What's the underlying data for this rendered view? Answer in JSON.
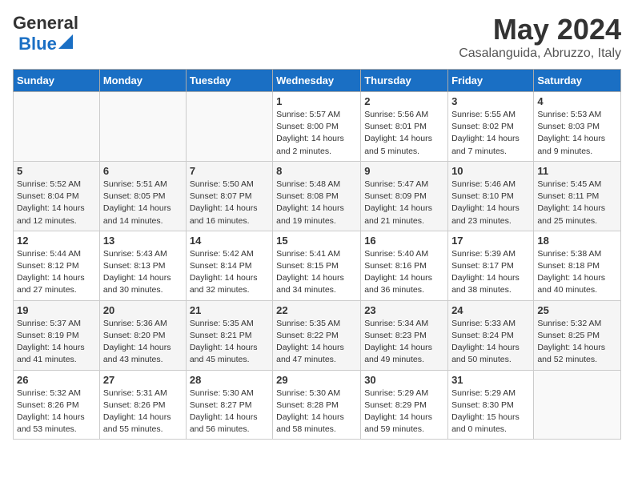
{
  "header": {
    "logo_top": "General",
    "logo_bottom": "Blue",
    "month": "May 2024",
    "location": "Casalanguida, Abruzzo, Italy"
  },
  "weekdays": [
    "Sunday",
    "Monday",
    "Tuesday",
    "Wednesday",
    "Thursday",
    "Friday",
    "Saturday"
  ],
  "weeks": [
    [
      {
        "day": "",
        "info": ""
      },
      {
        "day": "",
        "info": ""
      },
      {
        "day": "",
        "info": ""
      },
      {
        "day": "1",
        "info": "Sunrise: 5:57 AM\nSunset: 8:00 PM\nDaylight: 14 hours\nand 2 minutes."
      },
      {
        "day": "2",
        "info": "Sunrise: 5:56 AM\nSunset: 8:01 PM\nDaylight: 14 hours\nand 5 minutes."
      },
      {
        "day": "3",
        "info": "Sunrise: 5:55 AM\nSunset: 8:02 PM\nDaylight: 14 hours\nand 7 minutes."
      },
      {
        "day": "4",
        "info": "Sunrise: 5:53 AM\nSunset: 8:03 PM\nDaylight: 14 hours\nand 9 minutes."
      }
    ],
    [
      {
        "day": "5",
        "info": "Sunrise: 5:52 AM\nSunset: 8:04 PM\nDaylight: 14 hours\nand 12 minutes."
      },
      {
        "day": "6",
        "info": "Sunrise: 5:51 AM\nSunset: 8:05 PM\nDaylight: 14 hours\nand 14 minutes."
      },
      {
        "day": "7",
        "info": "Sunrise: 5:50 AM\nSunset: 8:07 PM\nDaylight: 14 hours\nand 16 minutes."
      },
      {
        "day": "8",
        "info": "Sunrise: 5:48 AM\nSunset: 8:08 PM\nDaylight: 14 hours\nand 19 minutes."
      },
      {
        "day": "9",
        "info": "Sunrise: 5:47 AM\nSunset: 8:09 PM\nDaylight: 14 hours\nand 21 minutes."
      },
      {
        "day": "10",
        "info": "Sunrise: 5:46 AM\nSunset: 8:10 PM\nDaylight: 14 hours\nand 23 minutes."
      },
      {
        "day": "11",
        "info": "Sunrise: 5:45 AM\nSunset: 8:11 PM\nDaylight: 14 hours\nand 25 minutes."
      }
    ],
    [
      {
        "day": "12",
        "info": "Sunrise: 5:44 AM\nSunset: 8:12 PM\nDaylight: 14 hours\nand 27 minutes."
      },
      {
        "day": "13",
        "info": "Sunrise: 5:43 AM\nSunset: 8:13 PM\nDaylight: 14 hours\nand 30 minutes."
      },
      {
        "day": "14",
        "info": "Sunrise: 5:42 AM\nSunset: 8:14 PM\nDaylight: 14 hours\nand 32 minutes."
      },
      {
        "day": "15",
        "info": "Sunrise: 5:41 AM\nSunset: 8:15 PM\nDaylight: 14 hours\nand 34 minutes."
      },
      {
        "day": "16",
        "info": "Sunrise: 5:40 AM\nSunset: 8:16 PM\nDaylight: 14 hours\nand 36 minutes."
      },
      {
        "day": "17",
        "info": "Sunrise: 5:39 AM\nSunset: 8:17 PM\nDaylight: 14 hours\nand 38 minutes."
      },
      {
        "day": "18",
        "info": "Sunrise: 5:38 AM\nSunset: 8:18 PM\nDaylight: 14 hours\nand 40 minutes."
      }
    ],
    [
      {
        "day": "19",
        "info": "Sunrise: 5:37 AM\nSunset: 8:19 PM\nDaylight: 14 hours\nand 41 minutes."
      },
      {
        "day": "20",
        "info": "Sunrise: 5:36 AM\nSunset: 8:20 PM\nDaylight: 14 hours\nand 43 minutes."
      },
      {
        "day": "21",
        "info": "Sunrise: 5:35 AM\nSunset: 8:21 PM\nDaylight: 14 hours\nand 45 minutes."
      },
      {
        "day": "22",
        "info": "Sunrise: 5:35 AM\nSunset: 8:22 PM\nDaylight: 14 hours\nand 47 minutes."
      },
      {
        "day": "23",
        "info": "Sunrise: 5:34 AM\nSunset: 8:23 PM\nDaylight: 14 hours\nand 49 minutes."
      },
      {
        "day": "24",
        "info": "Sunrise: 5:33 AM\nSunset: 8:24 PM\nDaylight: 14 hours\nand 50 minutes."
      },
      {
        "day": "25",
        "info": "Sunrise: 5:32 AM\nSunset: 8:25 PM\nDaylight: 14 hours\nand 52 minutes."
      }
    ],
    [
      {
        "day": "26",
        "info": "Sunrise: 5:32 AM\nSunset: 8:26 PM\nDaylight: 14 hours\nand 53 minutes."
      },
      {
        "day": "27",
        "info": "Sunrise: 5:31 AM\nSunset: 8:26 PM\nDaylight: 14 hours\nand 55 minutes."
      },
      {
        "day": "28",
        "info": "Sunrise: 5:30 AM\nSunset: 8:27 PM\nDaylight: 14 hours\nand 56 minutes."
      },
      {
        "day": "29",
        "info": "Sunrise: 5:30 AM\nSunset: 8:28 PM\nDaylight: 14 hours\nand 58 minutes."
      },
      {
        "day": "30",
        "info": "Sunrise: 5:29 AM\nSunset: 8:29 PM\nDaylight: 14 hours\nand 59 minutes."
      },
      {
        "day": "31",
        "info": "Sunrise: 5:29 AM\nSunset: 8:30 PM\nDaylight: 15 hours\nand 0 minutes."
      },
      {
        "day": "",
        "info": ""
      }
    ]
  ]
}
